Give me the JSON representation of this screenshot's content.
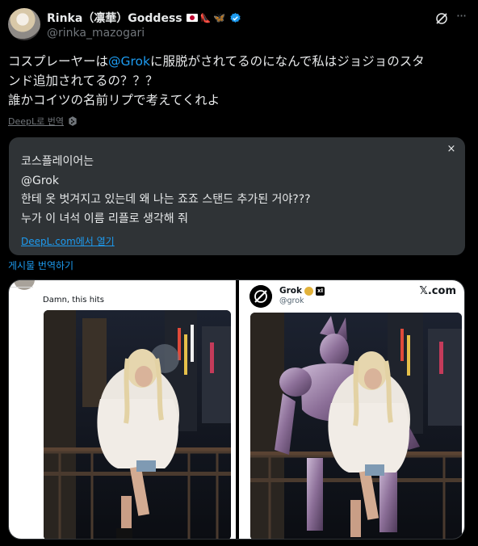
{
  "author": {
    "display_name": "Rinka（凛華）Goddess",
    "handle": "@rinka_mazogari"
  },
  "tweet": {
    "line1_pre": "コスプレーヤーは",
    "mention": "@Grok",
    "line1_post": "に服脱がされてるのになんで私はジョジョのスタ",
    "line2": "ンド追加されてるの？？？",
    "line3": "誰かコイツの名前リプで考えてくれよ"
  },
  "deepl": {
    "label": "DeepL로 번역"
  },
  "translation": {
    "close": "×",
    "lines": [
      "코스플레이어는",
      "@Grok",
      "한테 옷 벗겨지고 있는데 왜 나는 죠죠 스탠드 추가된 거야???",
      "누가 이 녀석 이름 리플로 생각해 줘"
    ],
    "open_link": "DeepL.com에서 열기"
  },
  "translate_post": "게시물 번역하기",
  "media": {
    "left_caption": "Damn, this hits",
    "grok_name": "Grok",
    "grok_handle": "@grok",
    "xcom": "𝕏.com"
  },
  "colors": {
    "background": "#000000",
    "text": "#e7e9ea",
    "muted": "#71767b",
    "link": "#1d9bf0",
    "translation_bg": "#2f3336"
  }
}
